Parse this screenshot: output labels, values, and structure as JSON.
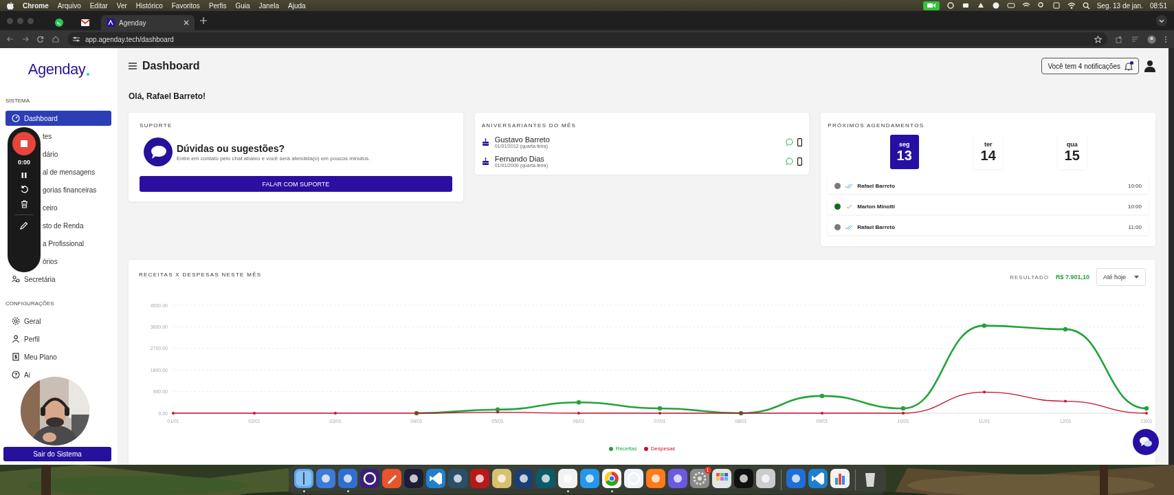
{
  "menu_bar": {
    "app": "Chrome",
    "menus": [
      "Arquivo",
      "Editar",
      "Ver",
      "Histórico",
      "Favoritos",
      "Perfis",
      "Guia",
      "Janela",
      "Ajuda"
    ],
    "date": "Seg. 13 de jan.",
    "time": "08:51"
  },
  "browser": {
    "tabs": [
      {
        "kind": "pinned",
        "selected": false
      },
      {
        "kind": "pinned",
        "selected": false
      },
      {
        "kind": "page",
        "title": "Agenday",
        "selected": true
      }
    ],
    "url": "app.agenday.tech/dashboard"
  },
  "sidebar": {
    "logo": "Agenday",
    "sections": [
      {
        "title": "SISTEMA",
        "items": [
          {
            "label": "Dashboard",
            "selected": true,
            "covered": false
          },
          {
            "label": "tes",
            "selected": false,
            "covered": true
          },
          {
            "label": "dário",
            "selected": false,
            "covered": true
          },
          {
            "label": "al de mensagens",
            "selected": false,
            "covered": true
          },
          {
            "label": "gorias financeiras",
            "selected": false,
            "covered": true
          },
          {
            "label": "ceiro",
            "selected": false,
            "covered": true
          },
          {
            "label": "sto de Renda",
            "selected": false,
            "covered": true
          },
          {
            "label": "a Profissional",
            "selected": false,
            "covered": true
          },
          {
            "label": "órios",
            "selected": false,
            "covered": true
          },
          {
            "label": "Secretária",
            "selected": false,
            "covered": false
          }
        ]
      },
      {
        "title": "CONFIGURAÇÕES",
        "items": [
          {
            "label": "Geral",
            "selected": false,
            "covered": false
          },
          {
            "label": "Perfil",
            "selected": false,
            "covered": false
          },
          {
            "label": "Meu Plano",
            "selected": false,
            "covered": false
          },
          {
            "label": "Ai",
            "selected": false,
            "covered": false
          }
        ]
      }
    ],
    "logout_button": "Sair do Sistema"
  },
  "header": {
    "title": "Dashboard",
    "notifications": "Você tem 4 notificações",
    "unread": true
  },
  "greeting": "Olá, Rafael Barreto!",
  "support_card": {
    "title": "SUPORTE",
    "heading": "Dúvidas ou sugestões?",
    "text": "Entre em contato pelo chat abaixo e você será atendida(o) em poucos minutos.",
    "button": "FALAR COM SUPORTE"
  },
  "birthdays_card": {
    "title": "ANIVERSARIANTES DO MÊS",
    "people": [
      {
        "name": "Gustavo Barreto",
        "date": "01/01/2012 (quarta-feira)"
      },
      {
        "name": "Fernando Dias",
        "date": "01/01/2000 (quarta-feira)"
      }
    ]
  },
  "appointments_card": {
    "title": "PRÓXIMOS AGENDAMENTOS",
    "days": [
      {
        "weekday": "seg",
        "day": "13",
        "selected": true
      },
      {
        "weekday": "ter",
        "day": "14",
        "selected": false
      },
      {
        "weekday": "qua",
        "day": "15",
        "selected": false
      }
    ],
    "appointments": [
      {
        "name": "Rafael Barreto",
        "time": "10:00",
        "color": "#7a7a7a",
        "kind": "double"
      },
      {
        "name": "Marlon Minotti",
        "time": "10:00",
        "color": "#17691f",
        "kind": "single"
      },
      {
        "name": "Rafael Barreto",
        "time": "11:00",
        "color": "#7a7a7a",
        "kind": "double"
      }
    ]
  },
  "finance_card": {
    "title": "RECEITAS X DESPESAS NESTE MÊS",
    "result_label": "RESULTADO",
    "result_value": "R$ 7.901,10",
    "period": "Até hoje",
    "chart_data": {
      "type": "line",
      "categories": [
        "01/01",
        "02/01",
        "03/01",
        "04/01",
        "05/01",
        "06/01",
        "07/01",
        "08/01",
        "09/01",
        "10/01",
        "11/01",
        "12/01",
        "13/01"
      ],
      "series": [
        {
          "name": "Receitas",
          "color": "#22a33a",
          "marker": true,
          "values": [
            null,
            null,
            null,
            0,
            150,
            450,
            200,
            0,
            720,
            200,
            3650,
            3500,
            200
          ]
        },
        {
          "name": "Despesas",
          "color": "#c8102e",
          "marker": true,
          "values": [
            0,
            0,
            0,
            0,
            40,
            0,
            0,
            0,
            0,
            0,
            880,
            500,
            0
          ]
        }
      ],
      "ylim": [
        0,
        4500
      ],
      "grid": true,
      "yticks": [
        {
          "value": 0,
          "label": "0.00"
        },
        {
          "value": 900,
          "label": "900.00"
        },
        {
          "value": 1800,
          "label": "1800.00"
        },
        {
          "value": 2700,
          "label": "2700.00"
        },
        {
          "value": 3600,
          "label": "3600.00"
        },
        {
          "value": 4500,
          "label": "4500.00"
        }
      ]
    }
  },
  "recorder": {
    "time": "0:00"
  },
  "dock": {
    "apps": [
      {
        "running": true
      },
      {
        "running": false
      },
      {
        "running": true
      },
      {
        "running": false
      },
      {
        "running": false
      },
      {
        "running": false
      },
      {
        "running": false
      },
      {
        "running": false
      },
      {
        "running": false
      },
      {
        "running": false
      },
      {
        "running": false
      },
      {
        "running": false
      },
      {
        "running": true
      },
      {
        "running": false
      },
      {
        "running": true
      },
      {
        "running": false
      },
      {
        "running": false
      },
      {
        "running": false
      },
      {
        "running": false,
        "badge": "1"
      },
      {
        "running": false
      },
      {
        "running": false
      },
      {
        "running": false
      },
      {
        "running": false
      },
      {
        "running": false
      },
      {
        "running": false
      },
      {
        "running": false
      }
    ]
  }
}
